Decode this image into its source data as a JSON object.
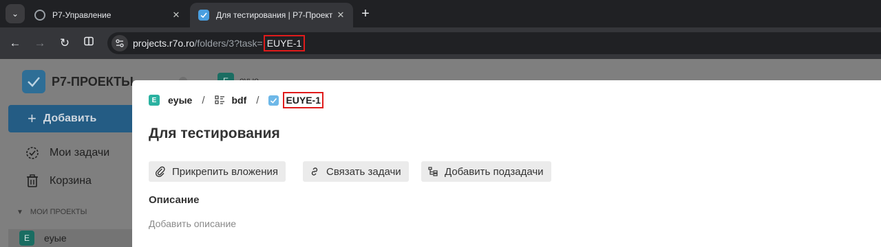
{
  "browser": {
    "tabs": [
      {
        "title": "Р7-Управление",
        "close": "✕"
      },
      {
        "title": "Для тестирования | Р7-Проект",
        "close": "✕"
      }
    ],
    "new_tab": "+",
    "url_host": "projects.r7o.ro",
    "url_path": "/folders/3?task=",
    "url_highlight": "EUYE-1"
  },
  "app": {
    "brand": "Р7-ПРОЕКТЫ",
    "add_button": "Добавить",
    "nav": {
      "my_tasks": "Мои задачи",
      "trash": "Корзина"
    },
    "section_title": "МОИ ПРОЕКТЫ",
    "project_badge": "E",
    "project_name": "eyыe",
    "bg_badge": "E",
    "bg_text": "eyыe"
  },
  "modal": {
    "breadcrumb": {
      "project_badge": "E",
      "project": "eyыe",
      "separator": "/",
      "board": "bdf",
      "task_key": "EUYE-1"
    },
    "title": "Для тестирования",
    "actions": {
      "attach": "Прикрепить вложения",
      "link": "Связать задачи",
      "subtasks": "Добавить подзадачи"
    },
    "description_label": "Описание",
    "description_placeholder": "Добавить описание"
  },
  "colors": {
    "highlight": "#e01b1b",
    "accent": "#2e6e96",
    "project_badge": "#2bb2a1"
  }
}
